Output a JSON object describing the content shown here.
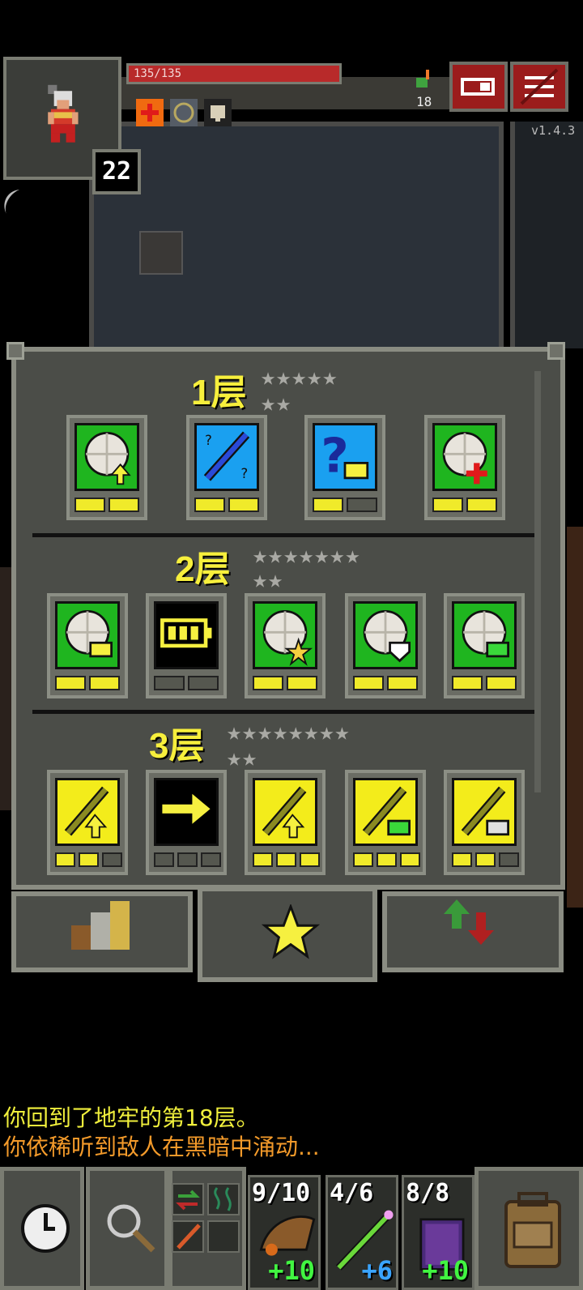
{
  "status": {
    "hp_text": "135/135",
    "hp_fraction": 1.0,
    "level": "22",
    "depth": "18",
    "version": "v1.4.3",
    "buffs": [
      "plus-buff-icon",
      "shield-buff-icon",
      "armor-buff-icon"
    ]
  },
  "panel": {
    "tiers": [
      {
        "title": "1层",
        "stars_row1": "★★★★★",
        "stars_row2": "★★",
        "talents": [
          {
            "icon": "food-up-icon",
            "color": "#1fb51f",
            "points": 2,
            "max": 2
          },
          {
            "icon": "wand-identify-icon",
            "color": "#1aa0f0",
            "points": 2,
            "max": 2
          },
          {
            "icon": "question-key-icon",
            "color": "#1aa0f0",
            "points": 1,
            "max": 2
          },
          {
            "icon": "food-heal-icon",
            "color": "#1fb51f",
            "points": 2,
            "max": 2
          }
        ]
      },
      {
        "title": "2层",
        "stars_row1": "★★★★★★★",
        "stars_row2": "★★",
        "talents": [
          {
            "icon": "food-key-icon",
            "color": "#1fb51f",
            "points": 2,
            "max": 2
          },
          {
            "icon": "battery-icon",
            "color": "#000000",
            "points": 0,
            "max": 2
          },
          {
            "icon": "food-star-icon",
            "color": "#1fb51f",
            "points": 2,
            "max": 2
          },
          {
            "icon": "food-shield-icon",
            "color": "#1fb51f",
            "points": 2,
            "max": 2
          },
          {
            "icon": "food-charge-icon",
            "color": "#1fb51f",
            "points": 2,
            "max": 2
          }
        ]
      },
      {
        "title": "3层",
        "stars_row1": "★★★★★★★★",
        "stars_row2": "★★",
        "talents": [
          {
            "icon": "staff-up-icon",
            "color": "#f3ec1b",
            "points": 2,
            "max": 3
          },
          {
            "icon": "arrow-right-icon",
            "color": "#000000",
            "points": 0,
            "max": 3
          },
          {
            "icon": "staff-up-icon",
            "color": "#f3ec1b",
            "points": 3,
            "max": 3
          },
          {
            "icon": "staff-charge-icon",
            "color": "#f3ec1b",
            "points": 3,
            "max": 3
          },
          {
            "icon": "staff-key-icon",
            "color": "#f3ec1b",
            "points": 2,
            "max": 3
          }
        ]
      }
    ]
  },
  "tabs": [
    {
      "name": "stats-tab",
      "icon": "bar-chart-icon"
    },
    {
      "name": "talents-tab",
      "icon": "star-icon"
    },
    {
      "name": "buffs-tab",
      "icon": "up-down-arrows-icon"
    }
  ],
  "log": {
    "line1": "你回到了地牢的第18层。",
    "line2": "你依稀听到敌人在黑暗中涌动...",
    "line1_color": "#f0ef3c",
    "line2_color": "#f39a2a"
  },
  "toolbar": {
    "quickslots": [
      {
        "charges": "9/10",
        "bonus": "+10",
        "bonus_color": "#41f541",
        "icon": "horn-icon"
      },
      {
        "charges": "4/6",
        "bonus": "+6",
        "bonus_color": "#3aa4ff",
        "icon": "wand-icon"
      },
      {
        "charges": "8/8",
        "bonus": "+10",
        "bonus_color": "#41f541",
        "icon": "spellbook-icon"
      }
    ]
  }
}
